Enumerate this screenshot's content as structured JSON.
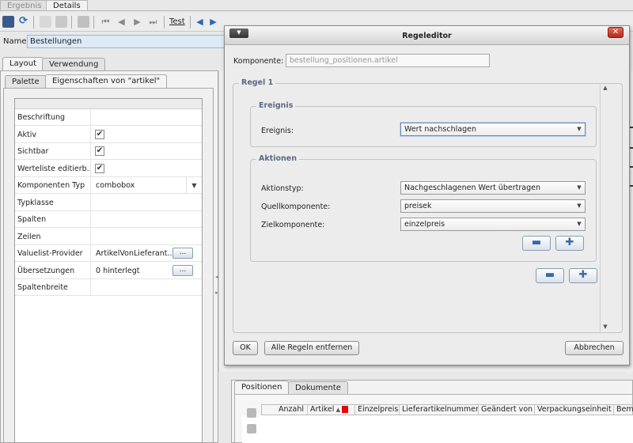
{
  "top_tabs": [
    "Ergebnis",
    "Details"
  ],
  "toolbar": {
    "test_label": "Test"
  },
  "name_field": {
    "label": "Name",
    "value": "Bestellungen"
  },
  "layout_tabs": [
    "Layout",
    "Verwendung"
  ],
  "sub_tabs": [
    "Palette",
    "Eigenschaften von \"artikel\""
  ],
  "properties": [
    {
      "name": "Beschriftung",
      "value": ""
    },
    {
      "name": "Aktiv",
      "value": "",
      "checked": true
    },
    {
      "name": "Sichtbar",
      "value": "",
      "checked": true
    },
    {
      "name": "Werteliste editierb...",
      "value": "",
      "checked": true
    },
    {
      "name": "Komponenten Typ",
      "value": "combobox"
    },
    {
      "name": "Typklasse",
      "value": ""
    },
    {
      "name": "Spalten",
      "value": ""
    },
    {
      "name": "Zeilen",
      "value": ""
    },
    {
      "name": "Valuelist-Provider",
      "value": "ArtikelVonLieferant..."
    },
    {
      "name": "Übersetzungen",
      "value": "0 hinterlegt"
    },
    {
      "name": "Spaltenbreite",
      "value": ""
    }
  ],
  "dots_label": "...",
  "dialog": {
    "title": "Regeleditor",
    "komponente_label": "Komponente:",
    "komponente_value": "bestellung_positionen.artikel",
    "regel_title": "Regel 1",
    "ereignis_group": "Ereignis",
    "ereignis_label": "Ereignis:",
    "ereignis_value": "Wert nachschlagen",
    "aktionen_group": "Aktionen",
    "aktionstyp_label": "Aktionstyp:",
    "aktionstyp_value": "Nachgeschlagenen Wert übertragen",
    "quell_label": "Quellkomponente:",
    "quell_value": "preisek",
    "ziel_label": "Zielkomponente:",
    "ziel_value": "einzelpreis",
    "ok_label": "OK",
    "remove_all_label": "Alle Regeln entfernen",
    "cancel_label": "Abbrechen"
  },
  "bottom_tabs": [
    "Positionen",
    "Dokumente"
  ],
  "grid_columns": [
    "Anzahl",
    "Artikel",
    "Einzelpreis",
    "Lieferartikelnummer",
    "Geändert von",
    "Verpackungseinheit",
    "Bem"
  ]
}
